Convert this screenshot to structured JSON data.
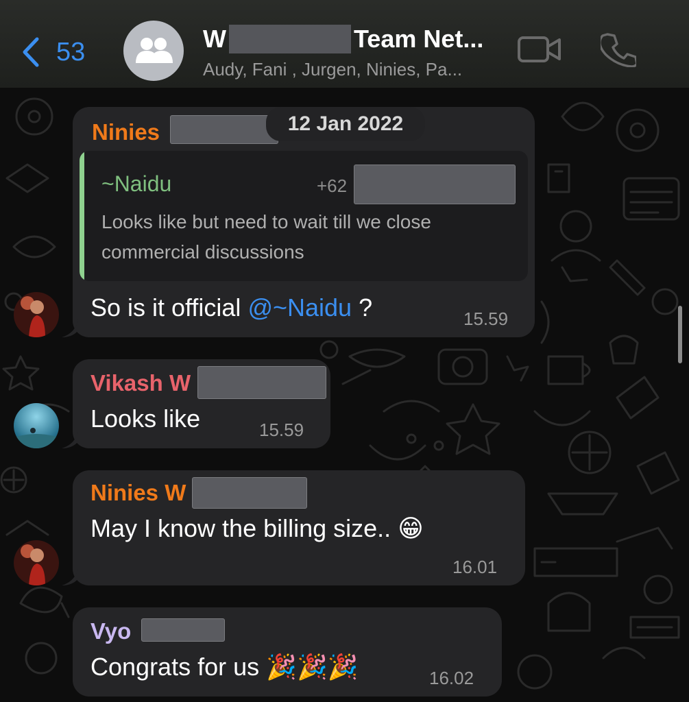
{
  "header": {
    "back_count": "53",
    "title_prefix": "W",
    "title_suffix": "Team Net...",
    "subtitle": "Audy, Fani , Jurgen, Ninies, Pa..."
  },
  "date_separator": "12 Jan 2022",
  "messages": [
    {
      "sender": "Ninies",
      "sender_color": "#f07a1a",
      "quote": {
        "author": "~Naidu",
        "phone_prefix": "+62",
        "text": "Looks like but need to wait till we close commercial discussions"
      },
      "text_before": "So is it official ",
      "mention": "@~Naidu",
      "text_after": " ?",
      "time": "15.59"
    },
    {
      "sender": "Vikash W",
      "sender_color": "#e8636b",
      "text": "Looks like",
      "time": "15.59"
    },
    {
      "sender": "Ninies W",
      "sender_color": "#f07a1a",
      "text": "May I know the billing size.. 😁",
      "time": "16.01"
    },
    {
      "sender": "Vyo",
      "sender_color": "#c9b8f0",
      "text": "Congrats for us 🎉🎉🎉",
      "time": "16.02"
    }
  ],
  "colors": {
    "accent": "#3b8ff0",
    "bubble": "#252527",
    "quote_bar": "#8fd18f"
  }
}
